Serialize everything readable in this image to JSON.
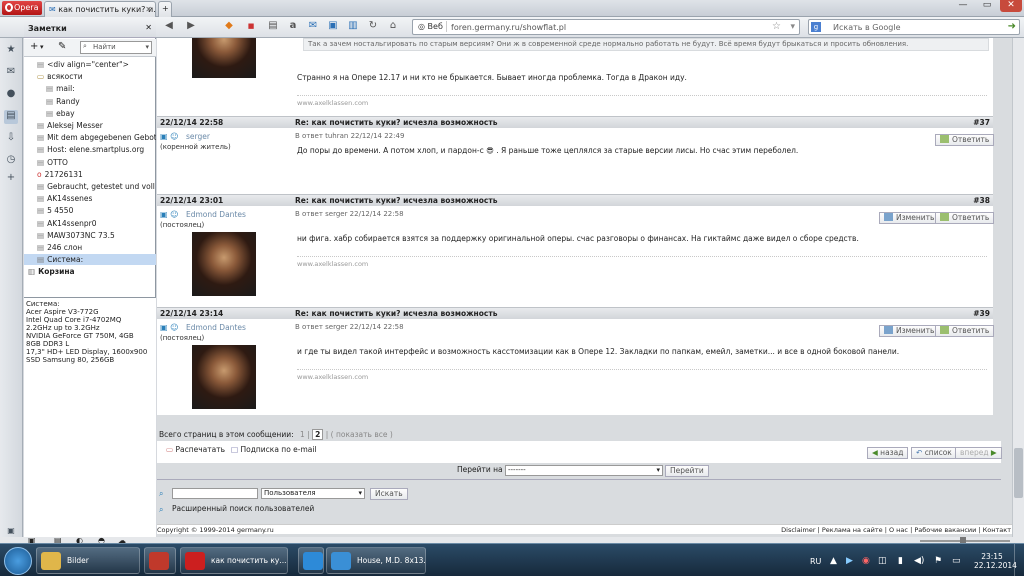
{
  "browser": {
    "opera_label": "Opera",
    "tab_title": "как почистить куки? и...",
    "address_prefix": "Веб",
    "url": "foren.germany.ru/showflat.pl",
    "search_placeholder": "Искать в Google",
    "window_controls": [
      "—",
      "▭",
      "✕"
    ]
  },
  "notes_panel": {
    "title": "Заметки",
    "search_placeholder": "Найти",
    "items": [
      {
        "label": "<div align=\"center\">",
        "indent": 1,
        "icon": "note"
      },
      {
        "label": "всякости",
        "indent": 1,
        "icon": "folder"
      },
      {
        "label": "mail:",
        "indent": 2,
        "icon": "note"
      },
      {
        "label": "Randy",
        "indent": 2,
        "icon": "note"
      },
      {
        "label": "ebay",
        "indent": 2,
        "icon": "note"
      },
      {
        "label": "Aleksej Messer",
        "indent": 1,
        "icon": "note"
      },
      {
        "label": "Mit dem abgegebenen Gebot ...",
        "indent": 1,
        "icon": "note"
      },
      {
        "label": "Host: elene.smartplus.org",
        "indent": 1,
        "icon": "note"
      },
      {
        "label": "OTTO",
        "indent": 1,
        "icon": "note"
      },
      {
        "label": "21726131",
        "indent": 1,
        "icon": "opera"
      },
      {
        "label": "Gebraucht, getestet und voll f...",
        "indent": 1,
        "icon": "note"
      },
      {
        "label": "AK14ssenes",
        "indent": 1,
        "icon": "note"
      },
      {
        "label": "5 4550",
        "indent": 1,
        "icon": "note"
      },
      {
        "label": "AK14ssenpr0",
        "indent": 1,
        "icon": "note"
      },
      {
        "label": "MAW3073NC 73.5",
        "indent": 1,
        "icon": "note"
      },
      {
        "label": "246 слон",
        "indent": 1,
        "icon": "note"
      },
      {
        "label": "Система:",
        "indent": 1,
        "icon": "note",
        "selected": true
      },
      {
        "label": "Корзина",
        "indent": 0,
        "icon": "trash",
        "bold": true
      }
    ],
    "detail_lines": [
      "Система:",
      "Acer Aspire V3-772G",
      "Intel Quad Core i7-4702MQ",
      "2.2GHz up to 3.2GHz",
      "NVIDIA GeForce GT 750M, 4GB",
      "8GB DDR3 L",
      "17,3\" HD+ LED Display, 1600x900",
      "SSD Samsung 80, 256GB"
    ]
  },
  "forum": {
    "top_fragment": {
      "quote": "Так а зачем ностальгировать по старым версиям? Они ж в современной среде нормально работать не будут. Всё время будут брыкаться и просить обновления.",
      "message": "Странно я на Опере 12.17 и ни кто не брыкается. Бывает иногда проблемка. Тогда в Дракон иду.",
      "signature": "www.axelklassen.com"
    },
    "posts": [
      {
        "date": "22/12/14 22:58",
        "title": "Re: как почистить куки? исчезла возможность",
        "number": "#37",
        "author": "serger",
        "status": "(коренной житель)",
        "reply_to": "В ответ tuhran 22/12/14 22:49",
        "message": "До поры до времени. А потом хлоп, и пардон-с 😎 . Я раньше тоже цеплялся за старые версии лисы. Но счас этим переболел.",
        "has_avatar": false,
        "edit_label": "",
        "reply_label": "Ответить",
        "signature": ""
      },
      {
        "date": "22/12/14 23:01",
        "title": "Re: как почистить куки? исчезла возможность",
        "number": "#38",
        "author": "Edmond Dantes",
        "status": "(постоялец)",
        "reply_to": "В ответ serger 22/12/14 22:58",
        "message": "ни фига. хабр собирается взятся за поддержку оригинальной оперы. счас разговоры о финансах. На гиктаймс даже видел о сборе средств.",
        "has_avatar": true,
        "edit_label": "Изменить",
        "reply_label": "Ответить",
        "signature": "www.axelklassen.com"
      },
      {
        "date": "22/12/14 23:14",
        "title": "Re: как почистить куки? исчезла возможность",
        "number": "#39",
        "author": "Edmond Dantes",
        "status": "(постоялец)",
        "reply_to": "В ответ serger 22/12/14 22:58",
        "message": "и где ты видел такой интерфейс и возможность касстомизации как в Опере 12. Закладки по папкам, емейл, заметки... и все в одной боковой панели.",
        "has_avatar": true,
        "edit_label": "Изменить",
        "reply_label": "Ответить",
        "signature": "www.axelklassen.com"
      }
    ],
    "pages_label": "Всего страниц в этом сообщении:",
    "pages": [
      "1",
      "2"
    ],
    "current_page": "2",
    "show_all": "показать все",
    "print_label": "Распечатать",
    "subscribe_label": "Подписка по e-mail",
    "nav_back": "назад",
    "nav_list": "список",
    "nav_forward": "вперед",
    "goto_label": "Перейти на",
    "goto_value": "-------",
    "goto_button": "Перейти",
    "search_scope": "Пользователя",
    "search_button": "Искать",
    "advanced_search": "Расширенный поиск пользователей",
    "copyright": "Copyright © 1999-2014 germany.ru",
    "footer_links": [
      "Disclaimer",
      "Реклама на сайте",
      "О нас",
      "Рабочие вакансии",
      "Контакт"
    ]
  },
  "taskbar": {
    "items": [
      {
        "label": "Bilder",
        "icon": "folder-icon",
        "color": "#e0b64a"
      },
      {
        "label": "",
        "icon": "app-icon",
        "color": "#c0392b"
      },
      {
        "label": "как почистить ку...",
        "icon": "opera-icon",
        "color": "#cc1f1f"
      },
      {
        "label": "",
        "icon": "ie-icon",
        "color": "#2d8ad8"
      },
      {
        "label": "House, M.D. 8x13....",
        "icon": "media-icon",
        "color": "#3a8fd6"
      }
    ],
    "lang": "RU",
    "time": "23:15",
    "date": "22.12.2014"
  }
}
